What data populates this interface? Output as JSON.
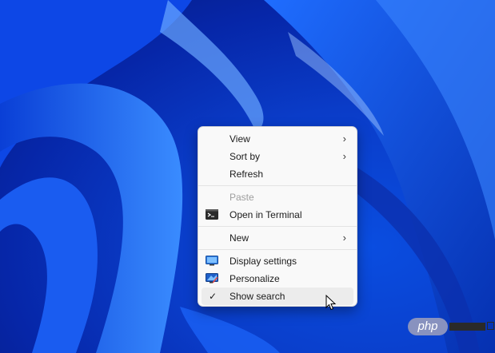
{
  "desktop": {
    "wallpaper": "windows-11-bloom-blue",
    "colors": {
      "accent": "#0a4de0",
      "deep": "#041a7a",
      "highlight": "#7fb0ff"
    }
  },
  "context_menu": {
    "items": [
      {
        "label": "View",
        "submenu": true
      },
      {
        "label": "Sort by",
        "submenu": true
      },
      {
        "label": "Refresh"
      },
      {
        "label": "Paste",
        "disabled": true
      },
      {
        "label": "Open in Terminal",
        "icon": "terminal-icon"
      },
      {
        "label": "New",
        "submenu": true
      },
      {
        "label": "Display settings",
        "icon": "display-settings-icon"
      },
      {
        "label": "Personalize",
        "icon": "personalize-icon"
      },
      {
        "label": "Show search",
        "checked": true,
        "hovered": true
      }
    ],
    "chevron_glyph": "›",
    "check_glyph": "✓"
  },
  "watermark": {
    "text": "php"
  }
}
